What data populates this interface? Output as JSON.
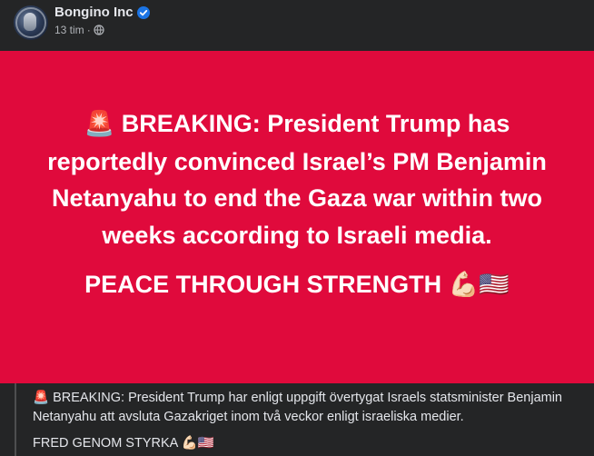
{
  "post": {
    "author": "Bongino Inc",
    "verified": true,
    "timestamp": "13 tim",
    "separator": "·",
    "audience_icon": "globe-icon"
  },
  "banner": {
    "background_color": "#e00a3c",
    "siren_emoji": "🚨",
    "headline": "BREAKING: President Trump has reportedly convinced Israel’s PM Benjamin Netanyahu to end the Gaza war within two weeks according to Israeli media.",
    "slogan": "PEACE THROUGH STRENGTH",
    "slogan_emoji": "💪🏻🇺🇸"
  },
  "translation": {
    "siren_emoji": "🚨",
    "text": "BREAKING: President Trump har enligt uppgift övertygat Israels statsminister Benjamin Netanyahu att avsluta Gazakriget inom två veckor enligt israeliska medier.",
    "slogan": "FRED GENOM STYRKA",
    "slogan_emoji": "💪🏻🇺🇸"
  },
  "colors": {
    "background": "#242526",
    "verified_badge": "#1b74e4",
    "text_primary": "#e4e6eb",
    "text_secondary": "#b0b3b8"
  }
}
